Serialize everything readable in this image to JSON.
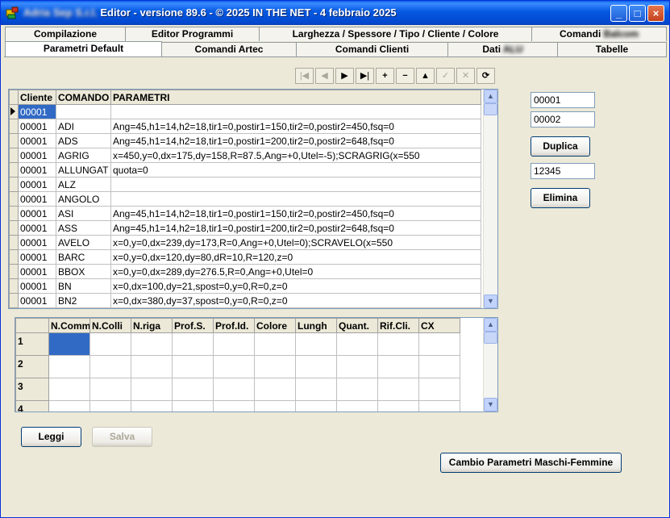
{
  "window": {
    "title_company": "Adria Sep S.r.l.",
    "title": "Editor - versione 89.6 - © 2025  IN THE NET - 4 febbraio 2025",
    "minimize": "_",
    "maximize": "□",
    "close": "×"
  },
  "tabs_row1": [
    {
      "label": "Compilazione"
    },
    {
      "label": "Editor Programmi"
    },
    {
      "label": "Larghezza / Spessore / Tipo / Cliente / Colore"
    },
    {
      "label": "Comandi",
      "blurred": "Balcom"
    }
  ],
  "tabs_row2": [
    {
      "label": "Parametri Default",
      "active": true
    },
    {
      "label": "Comandi Artec"
    },
    {
      "label": "Comandi Clienti"
    },
    {
      "label": "Dati",
      "blurred": "ALU"
    },
    {
      "label": "Tabelle"
    }
  ],
  "navigator": {
    "first": "|◀",
    "prior": "◀",
    "next": "▶",
    "last": "▶|",
    "insert": "+",
    "delete": "−",
    "edit": "▲",
    "post": "✓",
    "cancel": "✕",
    "refresh": "⟳"
  },
  "main_grid": {
    "columns": [
      "Cliente",
      "COMANDO",
      "PARAMETRI"
    ],
    "rows": [
      [
        "00001",
        "",
        ""
      ],
      [
        "00001",
        "ADI",
        "Ang=45,h1=14,h2=18,tir1=0,postir1=150,tir2=0,postir2=450,fsq=0"
      ],
      [
        "00001",
        "ADS",
        "Ang=45,h1=14,h2=18,tir1=0,postir1=200,tir2=0,postir2=648,fsq=0"
      ],
      [
        "00001",
        "AGRIG",
        "x=450,y=0,dx=175,dy=158,R=87.5,Ang=+0,Utel=-5);SCRAGRIG(x=550"
      ],
      [
        "00001",
        "ALLUNGAT",
        "quota=0"
      ],
      [
        "00001",
        "ALZ",
        ""
      ],
      [
        "00001",
        "ANGOLO",
        ""
      ],
      [
        "00001",
        "ASI",
        "Ang=45,h1=14,h2=18,tir1=0,postir1=150,tir2=0,postir2=450,fsq=0"
      ],
      [
        "00001",
        "ASS",
        "Ang=45,h1=14,h2=18,tir1=0,postir1=200,tir2=0,postir2=648,fsq=0"
      ],
      [
        "00001",
        "AVELO",
        "x=0,y=0,dx=239,dy=173,R=0,Ang=+0,Utel=0);SCRAVELO(x=550"
      ],
      [
        "00001",
        "BARC",
        "x=0,y=0,dx=120,dy=80,dR=10,R=120,z=0"
      ],
      [
        "00001",
        "BBOX",
        "x=0,y=0,dx=289,dy=276.5,R=0,Ang=+0,Utel=0"
      ],
      [
        "00001",
        "BN",
        "x=0,dx=100,dy=21,spost=0,y=0,R=0,z=0"
      ],
      [
        "00001",
        "BN2",
        "x=0,dx=380,dy=37,spost=0,y=0,R=0,z=0"
      ]
    ]
  },
  "detail_grid": {
    "columns": [
      "N.Comm",
      "N.Colli",
      "N.riga",
      "Prof.S.",
      "Prof.Id.",
      "Colore",
      "Lungh",
      "Quant.",
      "Rif.Cli.",
      "CX"
    ],
    "row_numbers": [
      "1",
      "2",
      "3",
      "4"
    ]
  },
  "side": {
    "field1": "00001",
    "field2": "00002",
    "duplica": "Duplica",
    "field3": "12345",
    "elimina": "Elimina"
  },
  "buttons": {
    "leggi": "Leggi",
    "salva": "Salva",
    "cambio": "Cambio Parametri Maschi-Femmine"
  }
}
